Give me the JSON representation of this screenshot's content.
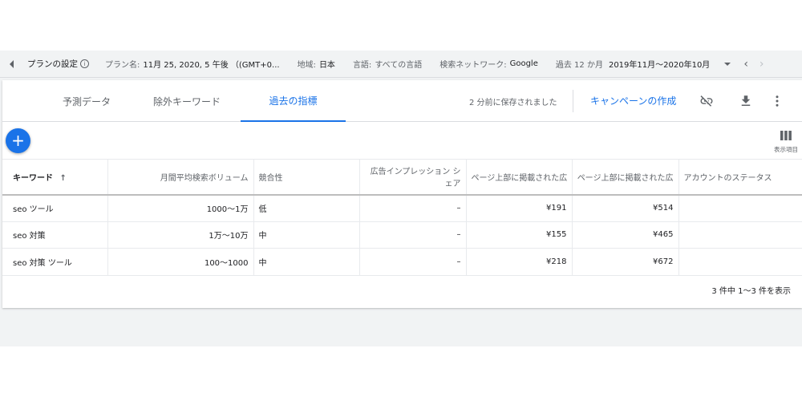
{
  "topbar": {
    "plan_settings": "プランの設定",
    "plan_name_label": "プラン名:",
    "plan_name_value": "11月 25, 2020, 5 午後 （(GMT+0...",
    "region_label": "地域:",
    "region_value": "日本",
    "language_label": "言語:",
    "language_value": "すべての言語",
    "network_label": "検索ネットワーク:",
    "network_value": "Google",
    "period_label": "過去 12 か月",
    "period_value": "2019年11月～2020年10月"
  },
  "tabs": [
    {
      "label": "予測データ"
    },
    {
      "label": "除外キーワード"
    },
    {
      "label": "過去の指標"
    }
  ],
  "header": {
    "saved_status": "2 分前に保存されました",
    "create_campaign": "キャンペーンの作成"
  },
  "icons": {
    "add": "plus-icon",
    "unlink": "link-off-icon",
    "download": "download-icon",
    "more": "more-vert-icon",
    "columns": "columns-icon"
  },
  "columns_label": "表示項目",
  "table": {
    "headers": {
      "keyword": "キーワード",
      "volume": "月間平均検索ボリューム",
      "competition": "競合性",
      "impression_share": "広告インプレッション シェア",
      "top_bid_low": "ページ上部に掲載された広",
      "top_bid_high": "ページ上部に掲載された広",
      "account_status": "アカウントのステータス"
    },
    "rows": [
      {
        "keyword": "seo ツール",
        "volume": "1000～1万",
        "competition": "低",
        "share": "–",
        "bid_low": "¥191",
        "bid_high": "¥514",
        "status": ""
      },
      {
        "keyword": "seo 対策",
        "volume": "1万～10万",
        "competition": "中",
        "share": "–",
        "bid_low": "¥155",
        "bid_high": "¥465",
        "status": ""
      },
      {
        "keyword": "seo 対策 ツール",
        "volume": "100～1000",
        "competition": "中",
        "share": "–",
        "bid_low": "¥218",
        "bid_high": "¥672",
        "status": ""
      }
    ]
  },
  "pagination": "3 件中 1～3 件を表示",
  "colors": {
    "accent": "#1a73e8",
    "background": "#f1f3f4"
  }
}
